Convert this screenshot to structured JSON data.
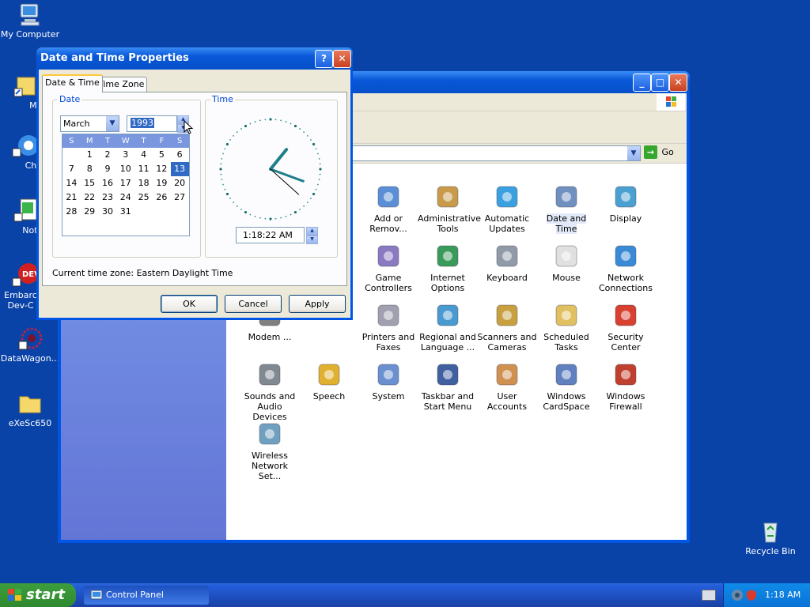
{
  "desktop": {
    "icons": [
      {
        "label": "My Computer"
      },
      {
        "label": "MyPa"
      },
      {
        "label": "Chrom"
      },
      {
        "label": "Notepa"
      },
      {
        "label": "Embarc Dev-C"
      },
      {
        "label": "DataWagon..."
      },
      {
        "label": "eXeSc650"
      },
      {
        "label": "Recycle Bin"
      }
    ]
  },
  "control_panel": {
    "go_label": "Go",
    "items": [
      {
        "label": "Add or Remov...",
        "icon": "add-remove-programs-icon"
      },
      {
        "label": "Administrative Tools",
        "icon": "administrative-tools-icon"
      },
      {
        "label": "Automatic Updates",
        "icon": "automatic-updates-icon"
      },
      {
        "label": "Date and Time",
        "icon": "date-time-icon"
      },
      {
        "label": "Display",
        "icon": "display-icon"
      },
      {
        "label": "Game Controllers",
        "icon": "game-controllers-icon"
      },
      {
        "label": "Internet Options",
        "icon": "internet-options-icon"
      },
      {
        "label": "Keyboard",
        "icon": "keyboard-icon"
      },
      {
        "label": "Mouse",
        "icon": "mouse-icon"
      },
      {
        "label": "Network Connections",
        "icon": "network-connections-icon"
      },
      {
        "label": "Modem ...",
        "icon": "modem-icon"
      },
      {
        "label": "Printers and Faxes",
        "icon": "printers-faxes-icon"
      },
      {
        "label": "Regional and Language ...",
        "icon": "regional-language-icon"
      },
      {
        "label": "Scanners and Cameras",
        "icon": "scanners-cameras-icon"
      },
      {
        "label": "Scheduled Tasks",
        "icon": "scheduled-tasks-icon"
      },
      {
        "label": "Security Center",
        "icon": "security-center-icon"
      },
      {
        "label": "Sounds and Audio Devices",
        "icon": "sounds-audio-icon"
      },
      {
        "label": "Speech",
        "icon": "speech-icon"
      },
      {
        "label": "System",
        "icon": "system-icon"
      },
      {
        "label": "Taskbar and Start Menu",
        "icon": "taskbar-start-menu-icon"
      },
      {
        "label": "User Accounts",
        "icon": "user-accounts-icon"
      },
      {
        "label": "Windows CardSpace",
        "icon": "windows-cardspace-icon"
      },
      {
        "label": "Windows Firewall",
        "icon": "windows-firewall-icon"
      },
      {
        "label": "Wireless Network Set...",
        "icon": "wireless-network-icon"
      }
    ]
  },
  "dialog": {
    "title": "Date and Time Properties",
    "help_label": "?",
    "tabs": [
      {
        "label": "Date & Time"
      },
      {
        "label": "Time Zone"
      }
    ],
    "date_group": "Date",
    "time_group": "Time",
    "month": "March",
    "year": "1993",
    "day_headers": [
      "S",
      "M",
      "T",
      "W",
      "T",
      "F",
      "S"
    ],
    "selected_day": 13,
    "days": [
      "",
      "1",
      "2",
      "3",
      "4",
      "5",
      "6",
      "7",
      "8",
      "9",
      "10",
      "11",
      "12",
      "13",
      "14",
      "15",
      "16",
      "17",
      "18",
      "19",
      "20",
      "21",
      "22",
      "23",
      "24",
      "25",
      "26",
      "27",
      "28",
      "29",
      "30",
      "31",
      "",
      "",
      ""
    ],
    "time": "1:18:22 AM",
    "clock": {
      "hour": 1,
      "minute": 18,
      "second": 22
    },
    "timezone_label": "Current time zone:",
    "timezone_value": "Eastern Daylight Time",
    "buttons": {
      "ok": "OK",
      "cancel": "Cancel",
      "apply": "Apply"
    }
  },
  "taskbar": {
    "start_label": "start",
    "window_button": "Control Panel",
    "clock": "1:18 AM"
  },
  "colors": {
    "desktop": "#0a43a8",
    "titlebar": "#0858d8",
    "dialog_face": "#ece9d8",
    "selection": "#316ac5",
    "clock_hands": "#1e7f8a"
  }
}
